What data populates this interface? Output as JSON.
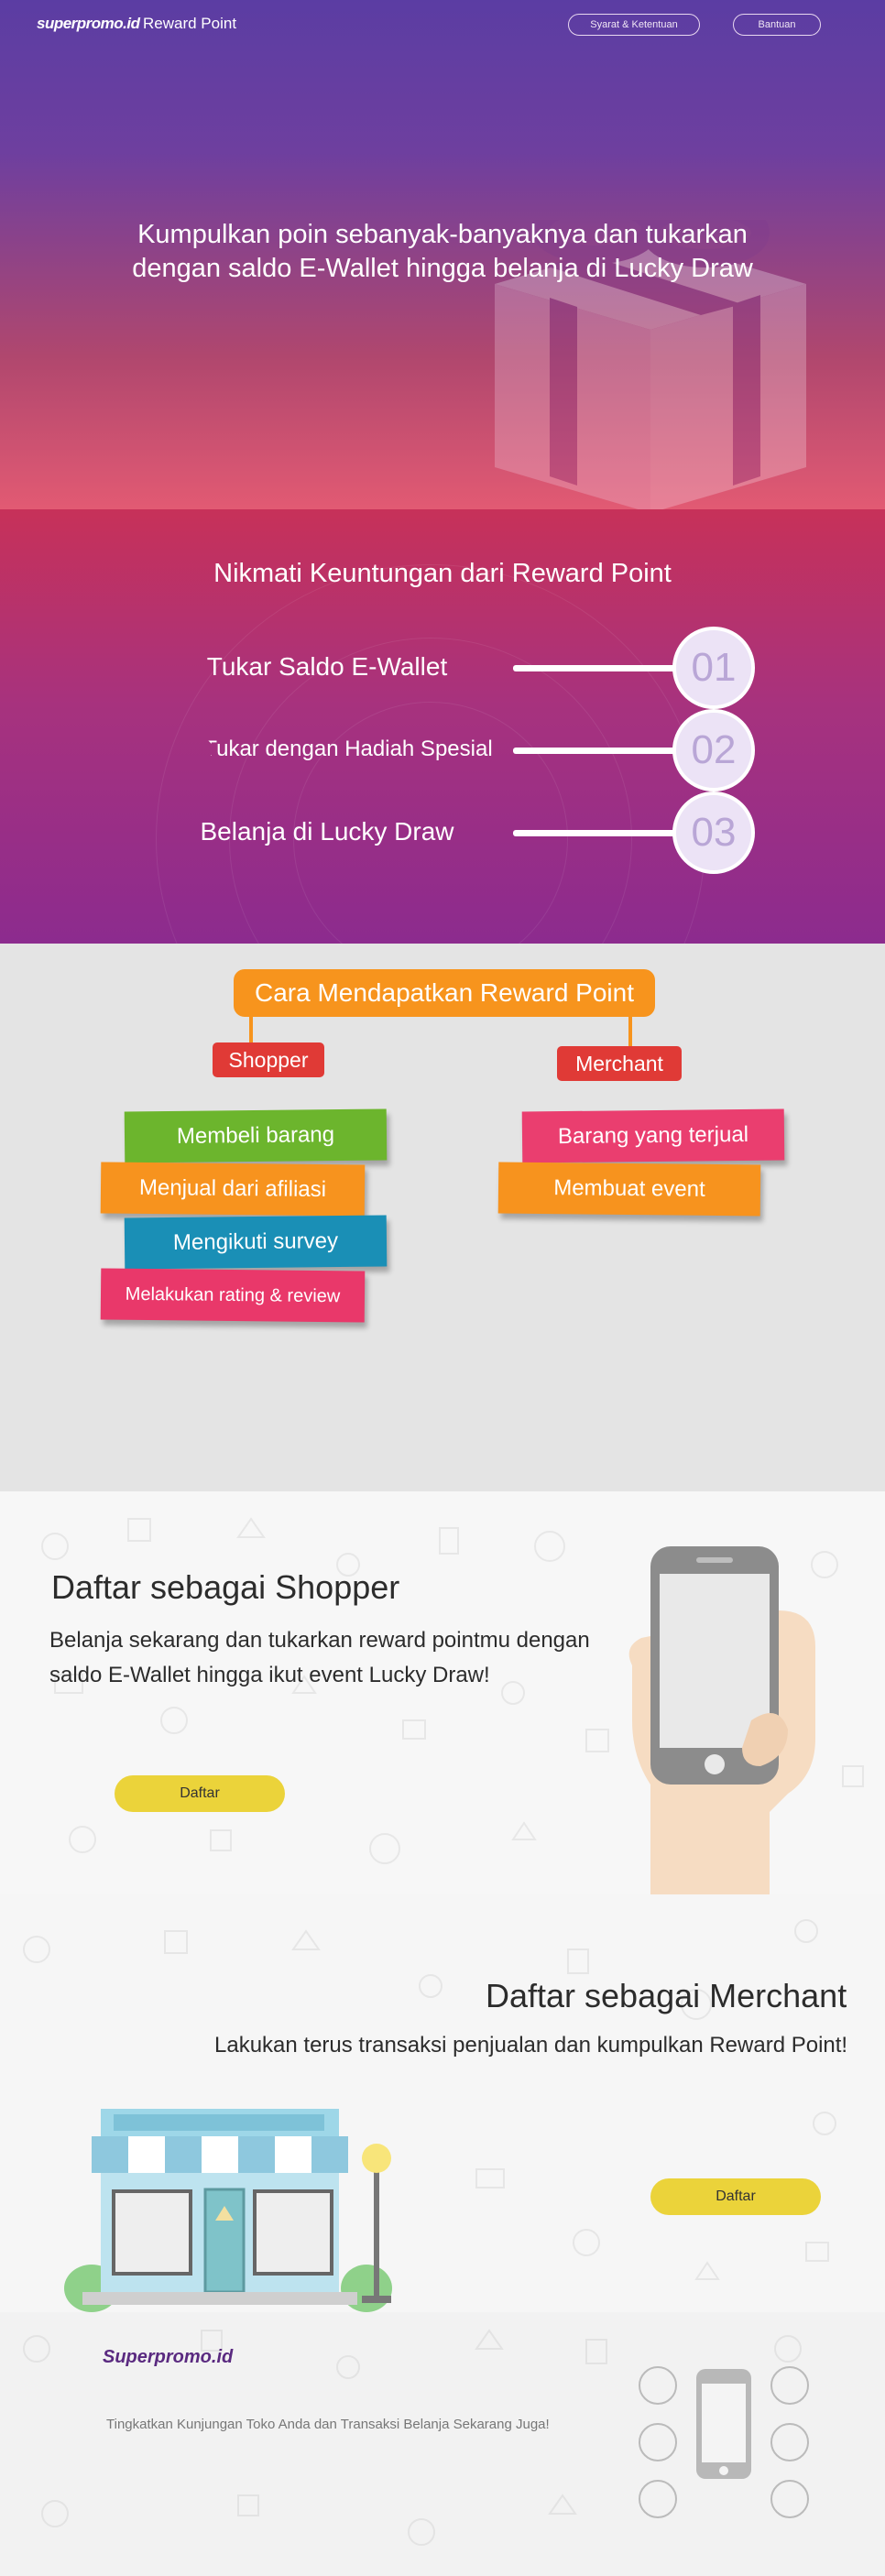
{
  "topbar": {
    "logo": "superpromo.id",
    "subtitle": "Reward Point",
    "terms_label": "Syarat & Ketentuan",
    "help_label": "Bantuan"
  },
  "hero": {
    "line1": "Kumpulkan poin sebanyak-banyaknya dan tukarkan",
    "line2": "dengan saldo E-Wallet hingga belanja di Lucky Draw"
  },
  "benefits": {
    "title": "Nikmati Keuntungan dari Reward Point",
    "items": [
      {
        "label": "Tukar Saldo E-Wallet",
        "number": "01",
        "color": "#f7931e"
      },
      {
        "label": "Tukar dengan Hadiah Spesial",
        "number": "02",
        "color": "#f26522"
      },
      {
        "label": "Belanja di Lucky Draw",
        "number": "03",
        "color": "#ee3b34"
      }
    ]
  },
  "howto": {
    "title": "Cara Mendapatkan Reward Point",
    "shopper_label": "Shopper",
    "merchant_label": "Merchant",
    "shopper_items": [
      {
        "label": "Membeli barang",
        "color": "#6cb52d"
      },
      {
        "label": "Menjual dari afiliasi",
        "color": "#f7931e"
      },
      {
        "label": "Mengikuti survey",
        "color": "#1a8fb6"
      },
      {
        "label": "Melakukan rating & review",
        "color": "#e9386a"
      }
    ],
    "merchant_items": [
      {
        "label": "Barang yang terjual",
        "color": "#ea3e6f"
      },
      {
        "label": "Membuat event",
        "color": "#f7931e"
      }
    ]
  },
  "shopper": {
    "title": "Daftar sebagai Shopper",
    "desc_line1": "Belanja sekarang dan tukarkan reward pointmu dengan",
    "desc_line2": "saldo E-Wallet hingga ikut event Lucky Draw!",
    "button": "Daftar"
  },
  "merchant": {
    "title": "Daftar sebagai Merchant",
    "desc": "Lakukan terus transaksi penjualan dan kumpulkan Reward Point!",
    "button": "Daftar"
  },
  "footer": {
    "logo": "Superpromo.id",
    "tagline": "Tingkatkan Kunjungan Toko Anda dan Transaksi Belanja Sekarang Juga!"
  }
}
